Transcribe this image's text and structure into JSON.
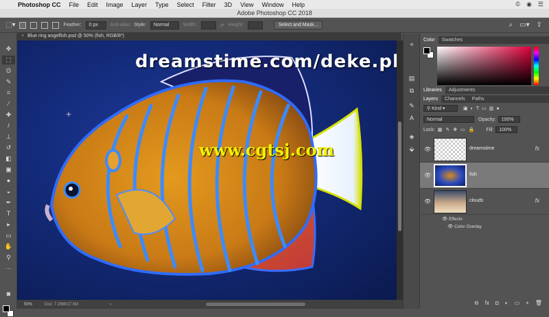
{
  "menubar": {
    "app": "Photoshop CC",
    "items": [
      "File",
      "Edit",
      "Image",
      "Layer",
      "Type",
      "Select",
      "Filter",
      "3D",
      "View",
      "Window",
      "Help"
    ],
    "status_icons": [
      "©",
      "◉",
      "☰"
    ]
  },
  "window": {
    "title": "Adobe Photoshop CC 2018"
  },
  "options": {
    "feather_label": "Feather:",
    "feather_value": "0 px",
    "anti_alias": "Anti-alias",
    "style_label": "Style:",
    "style_value": "Normal",
    "width_label": "Width:",
    "height_label": "Height:",
    "select_mask": "Select and Mask..."
  },
  "document": {
    "tab_title": "Blue ring angelfish.psd @ 50% (fish, RGB/8*)",
    "zoom": "50%",
    "doc_size": "Doc: 7.28M/17.0M"
  },
  "canvas": {
    "watermark_top": "dreamstime.com/deke.php",
    "watermark_mid": "www.cgtsj.com"
  },
  "color_panel": {
    "tabs": [
      "Color",
      "Swatches"
    ],
    "accent": "#e0003c"
  },
  "lib_panel": {
    "tabs": [
      "Libraries",
      "Adjustments"
    ]
  },
  "layers_panel": {
    "tabs": [
      "Layers",
      "Channels",
      "Paths"
    ],
    "filter": "Kind",
    "blend": "Normal",
    "opacity_label": "Opacity:",
    "opacity": "100%",
    "lock_label": "Lock:",
    "fill_label": "Fill:",
    "fill": "100%",
    "layers": [
      {
        "name": "dreamstime",
        "fx": "fx"
      },
      {
        "name": "fish",
        "fx": ""
      },
      {
        "name": "clouds",
        "fx": "fx"
      }
    ],
    "effects_label": "Effects",
    "color_overlay": "Color Overlay",
    "bottom_icons": [
      "⊖",
      "fx",
      "◘",
      "◐",
      "▭",
      "+",
      "🗑"
    ]
  }
}
